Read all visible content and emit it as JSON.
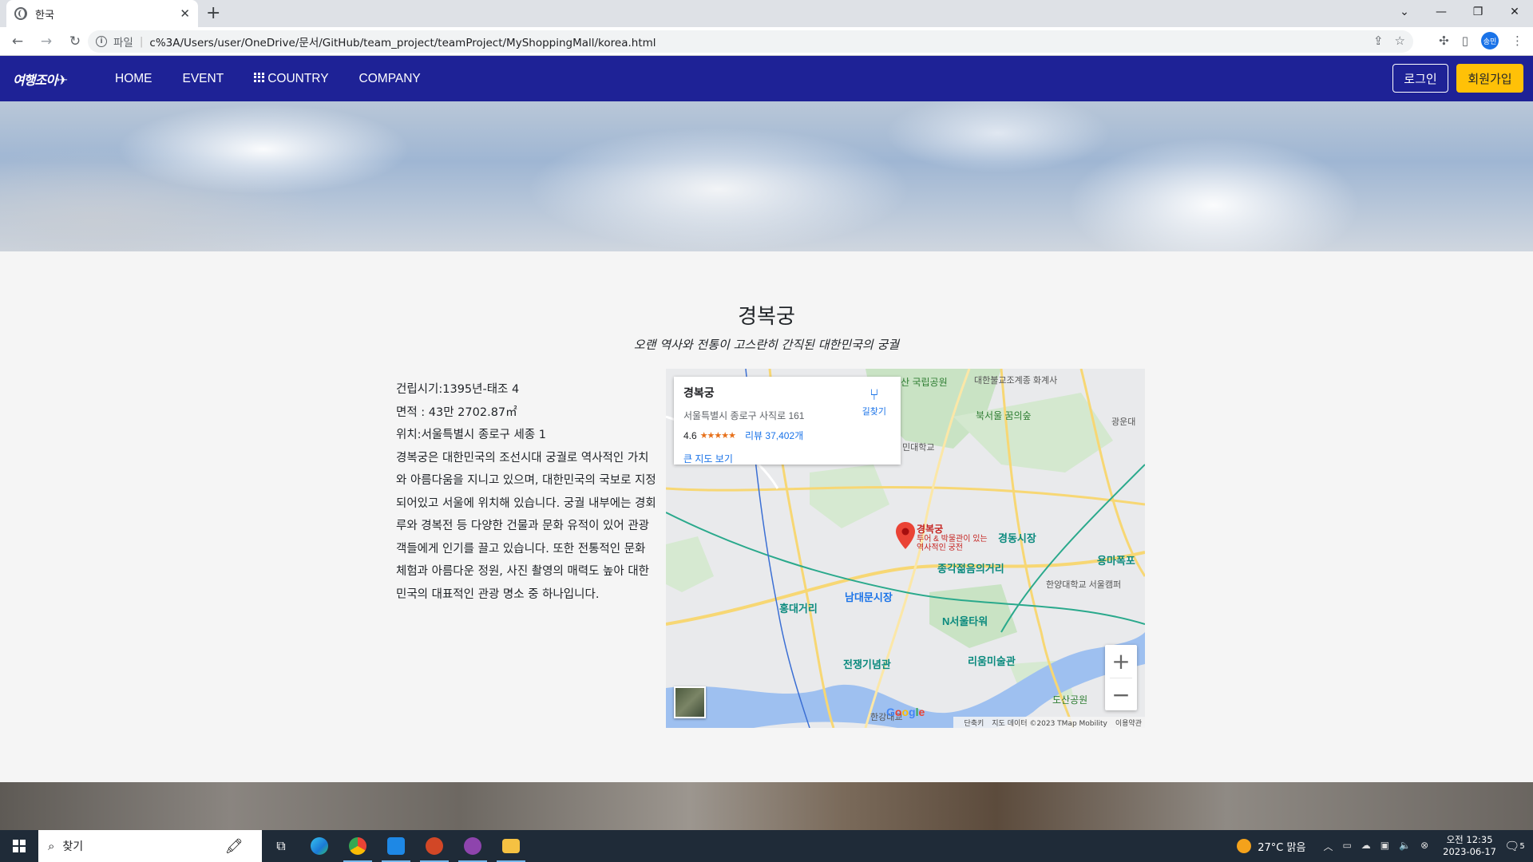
{
  "browser": {
    "tab_title": "한국",
    "new_tab": "+",
    "tab_close": "✕",
    "url_scheme": "파일",
    "url": "c%3A/Users/user/OneDrive/문서/GitHub/team_project/teamProject/MyShoppingMall/korea.html",
    "profile_initials": "송민"
  },
  "navbar": {
    "logo": "여행조이",
    "links": [
      "HOME",
      "EVENT",
      "COUNTRY",
      "COMPANY"
    ],
    "login": "로그인",
    "signup": "회원가입",
    "colors": {
      "bar": "#1e2296",
      "signup_bg": "#ffc107"
    }
  },
  "place": {
    "title": "경복궁",
    "subtitle": "오랜 역사와 전통이 고스란히 간직된 대한민국의 궁궐",
    "built": "건립시기:1395년-태조 4",
    "area": "면적 : 43만 2702.87㎡",
    "location": "위치:서울특별시 종로구 세종 1",
    "description": "경복궁은 대한민국의 조선시대 궁궐로 역사적인 가치와 아름다움을 지니고 있으며, 대한민국의 국보로 지정되어있고 서울에 위치해 있습니다. 궁궐 내부에는 경회루와 경복전 등 다양한 건물과 문화 유적이 있어 관광객들에게 인기를 끌고 있습니다. 또한 전통적인 문화 체험과 아름다운 정원, 사진 촬영의 매력도 높아 대한민국의 대표적인 관광 명소 중 하나입니다."
  },
  "map": {
    "card": {
      "name": "경복궁",
      "address": "서울특별시 종로구 사직로 161",
      "rating": "4.6",
      "stars": "★★★★★",
      "reviews": "리뷰 37,402개",
      "big_map": "큰 지도 보기",
      "directions": "길찾기"
    },
    "pin_label": "경복궁",
    "pin_sublabel": "투어 & 박물관이 있는 역사적인 궁전",
    "labels": {
      "bukhansan": "북한산 국립공원",
      "buddhist": "대한불교조계종 화계사",
      "dream_forest": "북서울 꿈의숲",
      "gwangun": "광운대",
      "minju": "민대학교",
      "gyeongdong": "경동시장",
      "yongma": "용마폭포",
      "jonggak": "종각젊음의거리",
      "namdaemun": "남대문시장",
      "hongdae": "홍대거리",
      "ntower": "N서울타워",
      "hanyang": "한양대학교 서울캠퍼",
      "leeum": "리움미술관",
      "war_memorial": "전쟁기념관",
      "dosan": "도산공원",
      "hangang_bridge": "한강대교"
    },
    "zoom_in": "+",
    "zoom_out": "−",
    "google": [
      "G",
      "o",
      "o",
      "g",
      "l",
      "e"
    ],
    "footer": [
      "단축키",
      "지도 데이터 ©2023 TMap Mobility",
      "이용약관"
    ]
  },
  "taskbar": {
    "search_label": "찾기",
    "weather": "27°C 맑음",
    "time": "오전 12:35",
    "date": "2023-06-17",
    "notifications": "5"
  }
}
